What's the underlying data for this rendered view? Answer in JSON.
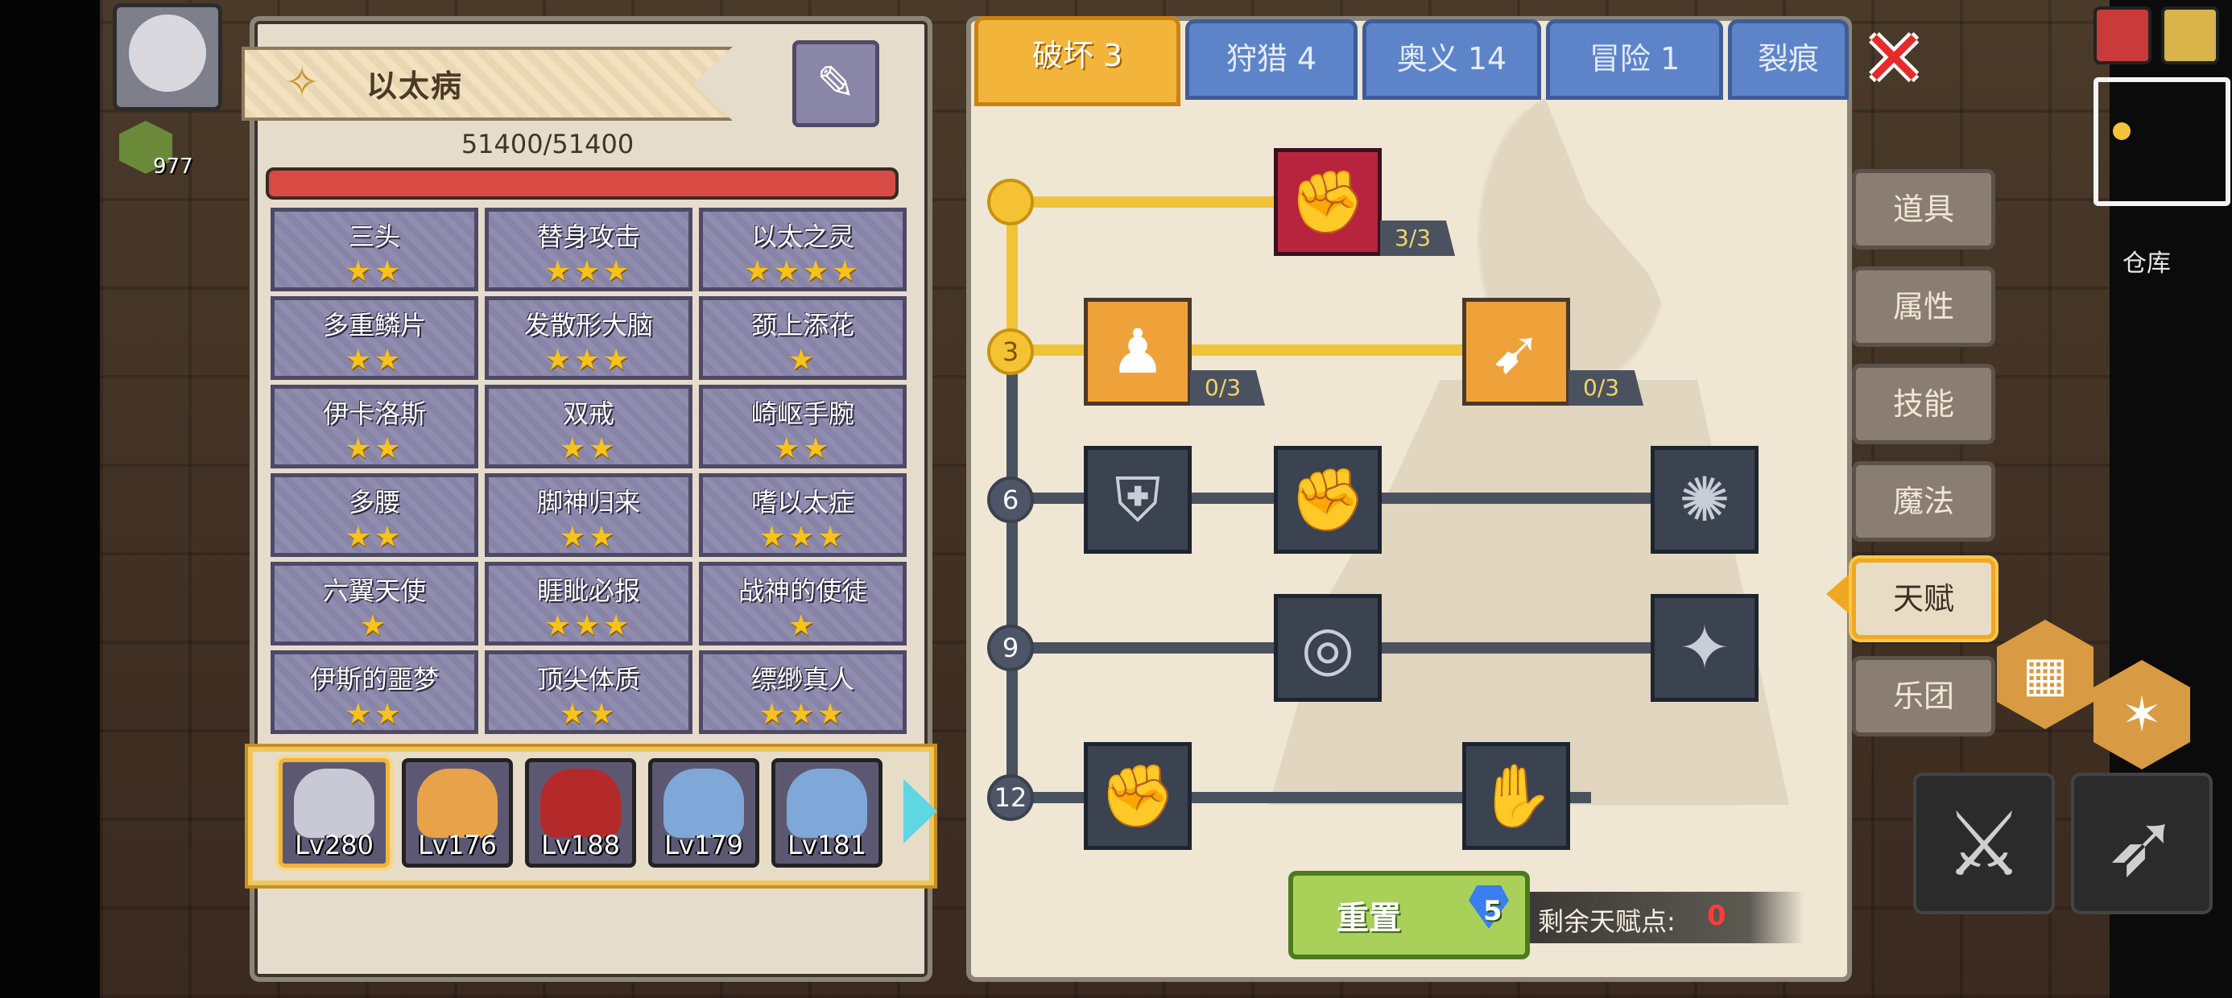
{
  "character": {
    "trait_title": "以太病",
    "hp_text": "51400/51400",
    "hp_fraction": 1.0
  },
  "traits": [
    {
      "name": "三头",
      "stars": 2
    },
    {
      "name": "替身攻击",
      "stars": 3
    },
    {
      "name": "以太之灵",
      "stars": 4
    },
    {
      "name": "多重鳞片",
      "stars": 2
    },
    {
      "name": "发散形大脑",
      "stars": 3
    },
    {
      "name": "颈上添花",
      "stars": 1
    },
    {
      "name": "伊卡洛斯",
      "stars": 2
    },
    {
      "name": "双戒",
      "stars": 2
    },
    {
      "name": "崎岖手腕",
      "stars": 2
    },
    {
      "name": "多腰",
      "stars": 2
    },
    {
      "name": "脚神归来",
      "stars": 2
    },
    {
      "name": "嗜以太症",
      "stars": 3
    },
    {
      "name": "六翼天使",
      "stars": 1
    },
    {
      "name": "睚眦必报",
      "stars": 3
    },
    {
      "name": "战神的使徒",
      "stars": 1
    },
    {
      "name": "伊斯的噩梦",
      "stars": 2
    },
    {
      "name": "顶尖体质",
      "stars": 2
    },
    {
      "name": "缥缈真人",
      "stars": 3
    }
  ],
  "heroes": [
    {
      "level": "Lv280",
      "selected": true,
      "color": "#c9c9d6"
    },
    {
      "level": "Lv176",
      "selected": false,
      "color": "#e8a24a"
    },
    {
      "level": "Lv188",
      "selected": false,
      "color": "#b42a2a"
    },
    {
      "level": "Lv179",
      "selected": false,
      "color": "#7fa8d8"
    },
    {
      "level": "Lv181",
      "selected": false,
      "color": "#7fa8d8"
    }
  ],
  "tabs": [
    {
      "label": "破坏 3",
      "active": true
    },
    {
      "label": "狩猎 4",
      "active": false
    },
    {
      "label": "奥义 14",
      "active": false
    },
    {
      "label": "冒险 1",
      "active": false
    },
    {
      "label": "裂痕",
      "active": false
    }
  ],
  "talent_tree": {
    "tiers": [
      "3",
      "6",
      "9",
      "12"
    ],
    "nodes": {
      "tier0_a": {
        "count": "3/3"
      },
      "tier3_a": {
        "count": "0/3"
      },
      "tier3_b": {
        "count": "0/3"
      }
    }
  },
  "reset": {
    "label": "重置",
    "cost": "5"
  },
  "remaining": {
    "label": "剩余天赋点:",
    "value": "0"
  },
  "side_menu": [
    {
      "label": "道具",
      "active": false
    },
    {
      "label": "属性",
      "active": false
    },
    {
      "label": "技能",
      "active": false
    },
    {
      "label": "魔法",
      "active": false
    },
    {
      "label": "天赋",
      "active": true
    },
    {
      "label": "乐团",
      "active": false
    }
  ],
  "hud": {
    "gold": "977",
    "storage_label": "仓库"
  },
  "icons": {
    "trait_icon": "ribbon-icon",
    "syringe": "syringe-icon",
    "close": "close-icon",
    "gem": "gem-icon"
  }
}
